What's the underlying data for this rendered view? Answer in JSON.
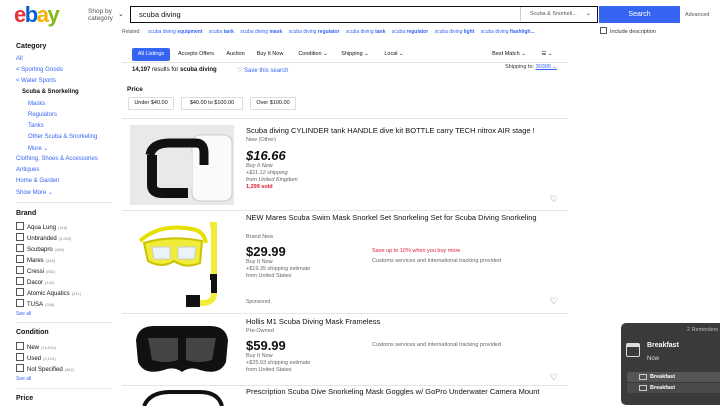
{
  "header": {
    "logo_letters": [
      {
        "ch": "e",
        "color": "#e53238"
      },
      {
        "ch": "b",
        "color": "#0064d2"
      },
      {
        "ch": "a",
        "color": "#f5af02"
      },
      {
        "ch": "y",
        "color": "#86b817"
      }
    ],
    "shop_by_line1": "Shop by",
    "shop_by_line2": "category",
    "search_value": "scuba diving",
    "category_select": "Scuba & Snorkeli...",
    "search_button": "Search",
    "advanced": "Advanced",
    "related_label": "Related:",
    "related": [
      {
        "pre": "scuba diving ",
        "bold": "equipment"
      },
      {
        "pre": "scuba ",
        "bold": "tank"
      },
      {
        "pre": "scuba diving ",
        "bold": "mask"
      },
      {
        "pre": "scuba diving ",
        "bold": "regulator"
      },
      {
        "pre": "scuba diving ",
        "bold": "tank"
      },
      {
        "pre": "scuba ",
        "bold": "regulator"
      },
      {
        "pre": "scuba diving ",
        "bold": "light"
      },
      {
        "pre": "scuba diving ",
        "bold": "flashligh..."
      }
    ],
    "include_description": "Include description"
  },
  "sidebar": {
    "category_heading": "Category",
    "all": "All",
    "crumbs": [
      "< Sporting Goods",
      "< Water Sports"
    ],
    "current": "Scuba & Snorkeling",
    "subcats": [
      "Masks",
      "Regulators",
      "Tanks",
      "Other Scuba & Snorkeling",
      "More ⌄"
    ],
    "siblings": [
      "Clothing, Shoes & Accessories",
      "Antiques",
      "Home & Garden",
      "Show More ⌄"
    ],
    "brand_heading": "Brand",
    "brands": [
      {
        "name": "Aqua Lung",
        "count": "(318)"
      },
      {
        "name": "Unbranded",
        "count": "(3,653)"
      },
      {
        "name": "Scubapro",
        "count": "(468)"
      },
      {
        "name": "Mares",
        "count": "(348)"
      },
      {
        "name": "Cressi",
        "count": "(831)"
      },
      {
        "name": "Dacor",
        "count": "(142)"
      },
      {
        "name": "Atomic Aquatics",
        "count": "(241)"
      },
      {
        "name": "TUSA",
        "count": "(348)"
      }
    ],
    "see_all": "See all",
    "condition_heading": "Condition",
    "conditions": [
      {
        "name": "New",
        "count": "(16,019)"
      },
      {
        "name": "Used",
        "count": "(3,104)"
      },
      {
        "name": "Not Specified",
        "count": "(462)"
      }
    ],
    "price_heading": "Price"
  },
  "filters": {
    "buttons": [
      "All Listings",
      "Accepts Offers",
      "Auction",
      "Buy It Now",
      "Condition ⌄",
      "Shipping ⌄",
      "Local ⌄"
    ],
    "sort": "Best Match ⌄",
    "view": "☰ ⌄",
    "results_count": "14,197",
    "results_text": " results for ",
    "results_query": "scuba diving",
    "save_search": "♡ Save this search",
    "ship_to_label": "Shipping to: ",
    "ship_to_value": "30305 ⌄",
    "price_heading": "Price",
    "price_buttons": [
      "Under $40.00",
      "$40.00 to $100.00",
      "Over $100.00"
    ]
  },
  "listings": [
    {
      "title": "Scuba diving CYLINDER tank HANDLE dive kit BOTTLE carry TECH nitrox AIR stage !",
      "condition": "New (Other)",
      "price": "$16.66",
      "buy": "Buy It Now",
      "shipping": "+$11.12 shipping",
      "from": "from United Kingdom",
      "sold": "1,299 sold"
    },
    {
      "title": "NEW Mares Scuba Swim Mask Snorkel Set Snorkeling Set for Scuba Diving Snorkeling",
      "condition": "Brand New",
      "price": "$29.99",
      "buy": "Buy It Now",
      "shipping": "+$19.35 shipping estimate",
      "from": "from United States",
      "promo": "Save up to 10% when you buy more",
      "customs": "Customs services and international tracking provided",
      "sponsored": "Sponsored"
    },
    {
      "title": "Hollis M1 Scuba Diving Mask Frameless",
      "condition": "Pre-Owned",
      "price": "$59.99",
      "buy": "Buy It Now",
      "shipping": "+$25.93 shipping estimate",
      "from": "from United States",
      "customs": "Customs services and international tracking provided"
    },
    {
      "title": "Prescription Scuba Dive Snorkeling Mask Goggles w/ GoPro Underwater Camera Mount"
    }
  ],
  "notification": {
    "count_label": "2 Reminders",
    "title": "Breakfast",
    "time": "Now",
    "items": [
      "Breakfast",
      "Breakfast"
    ]
  }
}
